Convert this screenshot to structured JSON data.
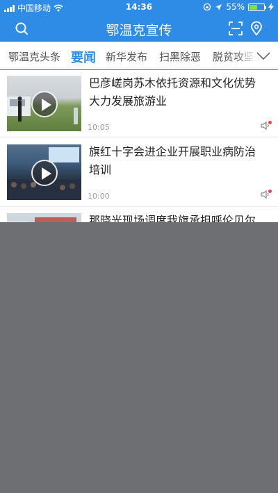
{
  "status_bar": {
    "carrier": "中国移动",
    "time": "14:36",
    "battery_percent": "55%",
    "battery_level": 0.55
  },
  "header": {
    "title": "鄂温克宣传",
    "left_icon": "search-icon",
    "right_icons": [
      "scan-icon",
      "location-icon"
    ]
  },
  "tabs": {
    "items": [
      {
        "label": "鄂温克头条"
      },
      {
        "label": "要闻"
      },
      {
        "label": "新华发布"
      },
      {
        "label": "扫黑除恶"
      },
      {
        "label": "脱贫攻坚"
      }
    ],
    "active_index": 1,
    "more_icon": "chevron-down-icon"
  },
  "news": [
    {
      "title": "巴彦嵯岗苏木依托资源和文化优势大力发展旅游业",
      "time": "10:05",
      "has_video": true
    },
    {
      "title": "旗红十字会进企业开展职业病防治培训",
      "time": "10:00",
      "has_video": true
    },
    {
      "title": "那晓光现场调度我旗承担呼伦贝尔",
      "time": "",
      "has_video": true
    }
  ],
  "colors": {
    "accent": "#2f8ce6",
    "overlay": "#6e6f73",
    "unread_dot": "#e54848"
  }
}
